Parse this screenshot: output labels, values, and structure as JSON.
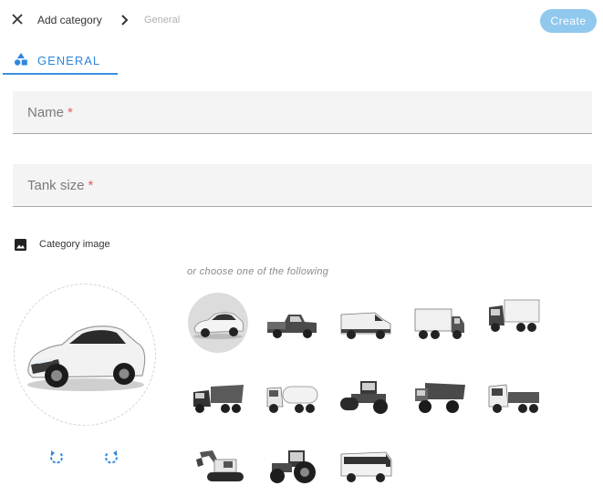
{
  "header": {
    "breadcrumb_main": "Add category",
    "breadcrumb_sub": "General",
    "create_label": "Create"
  },
  "tab": {
    "label": "GENERAL"
  },
  "form": {
    "name_label": "Name",
    "tank_size_label": "Tank size",
    "required_mark": "*"
  },
  "category_image": {
    "label": "Category image",
    "choose_text": "or choose one of the following",
    "presets": [
      {
        "name": "car",
        "selected": true
      },
      {
        "name": "pickup-truck",
        "selected": false
      },
      {
        "name": "van",
        "selected": false
      },
      {
        "name": "box-truck",
        "selected": false
      },
      {
        "name": "semi-truck-trailer",
        "selected": false
      },
      {
        "name": "dump-truck",
        "selected": false
      },
      {
        "name": "tanker-truck",
        "selected": false
      },
      {
        "name": "road-roller",
        "selected": false
      },
      {
        "name": "mining-dump-truck",
        "selected": false
      },
      {
        "name": "flatbed-truck",
        "selected": false
      },
      {
        "name": "excavator",
        "selected": false
      },
      {
        "name": "tractor",
        "selected": false
      },
      {
        "name": "bus",
        "selected": false
      }
    ]
  },
  "colors": {
    "accent": "#2e86de",
    "create_button": "#90c8ee",
    "required": "#e2625b",
    "field_bg": "#f4f4f4"
  }
}
